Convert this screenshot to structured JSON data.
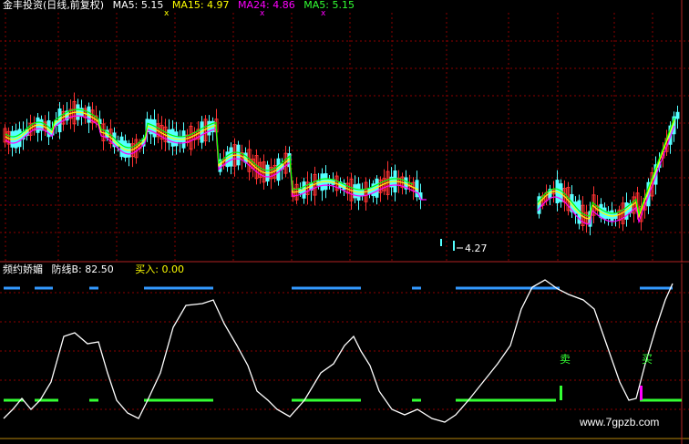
{
  "main_pane": {
    "title": "金丰投资(日线,前复权)",
    "indicators": [
      {
        "label": "MA5:",
        "value": "5.15",
        "color": "#ffffff"
      },
      {
        "label": "MA15:",
        "value": "4.97",
        "color": "#ffff00"
      },
      {
        "label": "MA24:",
        "value": "4.86",
        "color": "#ff00ff"
      },
      {
        "label": "MA5:",
        "value": "5.15",
        "color": "#00ff00"
      }
    ],
    "low_price_label": "4.27"
  },
  "indicator_pane": {
    "title": "频约娇媚",
    "line_label": "防线B:",
    "line_value": "82.50",
    "buy_label": "买入:",
    "buy_value": "0.00",
    "sell_marker": "卖",
    "buy_marker": "买"
  },
  "watermark": "www.7gpzb.com",
  "colors": {
    "up": "#ff3232",
    "down": "#54ffff",
    "ma5": "#ffffff",
    "ma15": "#ffff00",
    "ma24": "#ff00ff",
    "grid": "#8b0000",
    "blue_band": "#3399ff",
    "green_band": "#33ff33"
  }
}
